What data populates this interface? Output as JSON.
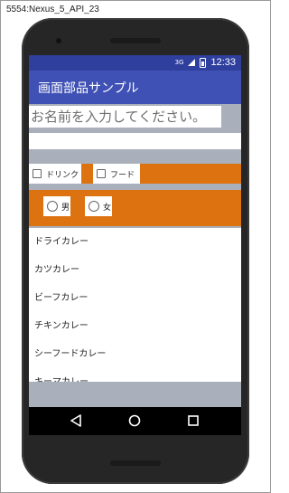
{
  "window": {
    "title": "5554:Nexus_5_API_23"
  },
  "status_bar": {
    "network": "3G",
    "time": "12:33"
  },
  "app_bar": {
    "title": "画面部品サンプル"
  },
  "form": {
    "name_placeholder": "お名前を入力してください。",
    "checkboxes": [
      {
        "label": "ドリンク",
        "checked": false
      },
      {
        "label": "フード",
        "checked": false
      }
    ],
    "radios": [
      {
        "label": "男",
        "selected": false
      },
      {
        "label": "女",
        "selected": false
      }
    ]
  },
  "menu_list": {
    "items": [
      "ドライカレー",
      "カツカレー",
      "ビーフカレー",
      "チキンカレー",
      "シーフードカレー",
      "キーマカレー"
    ]
  },
  "colors": {
    "app_bar": "#3f51b5",
    "status_bar": "#2f3f9e",
    "accent_orange": "#dd7210"
  },
  "nav_icons": [
    "back-icon",
    "home-icon",
    "recents-icon"
  ]
}
